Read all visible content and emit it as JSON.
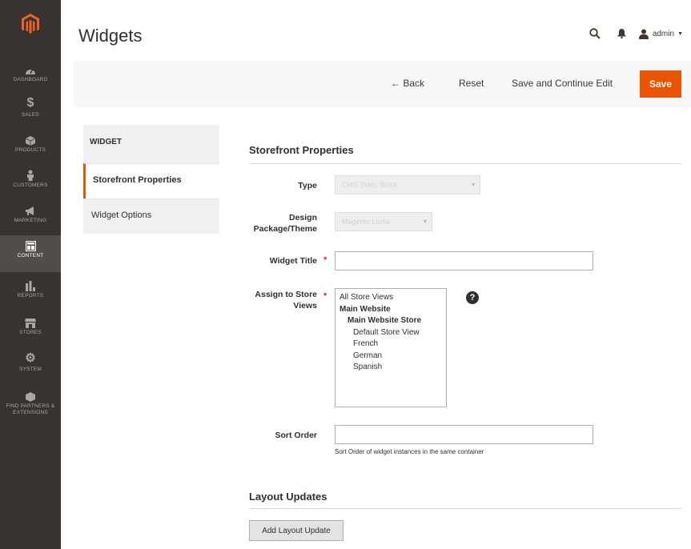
{
  "sidebar": {
    "logo_icon": "magento-logo",
    "items": [
      {
        "label": "DASHBOARD",
        "icon": "dashboard-gauge-icon"
      },
      {
        "label": "SALES",
        "icon": "dollar-icon"
      },
      {
        "label": "PRODUCTS",
        "icon": "cube-icon"
      },
      {
        "label": "CUSTOMERS",
        "icon": "person-icon"
      },
      {
        "label": "MARKETING",
        "icon": "megaphone-icon"
      },
      {
        "label": "CONTENT",
        "icon": "layout-icon"
      },
      {
        "label": "REPORTS",
        "icon": "bar-chart-icon"
      },
      {
        "label": "STORES",
        "icon": "storefront-icon"
      },
      {
        "label": "SYSTEM",
        "icon": "gear-icon"
      },
      {
        "label": "FIND PARTNERS & EXTENSIONS",
        "icon": "box-icon"
      }
    ],
    "active_index": 5
  },
  "header": {
    "title": "Widgets",
    "user": "admin"
  },
  "toolbar": {
    "back_label": "← Back",
    "reset_label": "Reset",
    "save_continue_label": "Save and Continue Edit",
    "save_label": "Save"
  },
  "tabs": {
    "title": "WIDGET",
    "items": [
      {
        "label": "Storefront Properties",
        "active": true
      },
      {
        "label": "Widget Options",
        "active": false
      }
    ]
  },
  "storefront": {
    "section_title": "Storefront Properties",
    "type_label": "Type",
    "type_value": "CMS Static Block",
    "design_label_1": "Design",
    "design_label_2": "Package/Theme",
    "design_value": "Magento Luma",
    "widget_title_label": "Widget Title",
    "widget_title_value": "",
    "assign_label_1": "Assign to Store",
    "assign_label_2": "Views",
    "store_options": [
      {
        "label": "All Store Views",
        "level": 0,
        "bold": false
      },
      {
        "label": "Main Website",
        "level": 0,
        "bold": true
      },
      {
        "label": "Main Website Store",
        "level": 1,
        "bold": true
      },
      {
        "label": "Default Store View",
        "level": 2,
        "bold": false
      },
      {
        "label": "French",
        "level": 2,
        "bold": false
      },
      {
        "label": "German",
        "level": 2,
        "bold": false
      },
      {
        "label": "Spanish",
        "level": 2,
        "bold": false
      }
    ],
    "help_glyph": "?",
    "sort_order_label": "Sort Order",
    "sort_order_value": "",
    "sort_order_note": "Sort Order of widget instances in the same container"
  },
  "layout_updates": {
    "section_title": "Layout Updates",
    "add_button_label": "Add Layout Update"
  },
  "colors": {
    "accent": "#eb5202",
    "sidebar_bg": "#373330",
    "required": "#e22626"
  }
}
